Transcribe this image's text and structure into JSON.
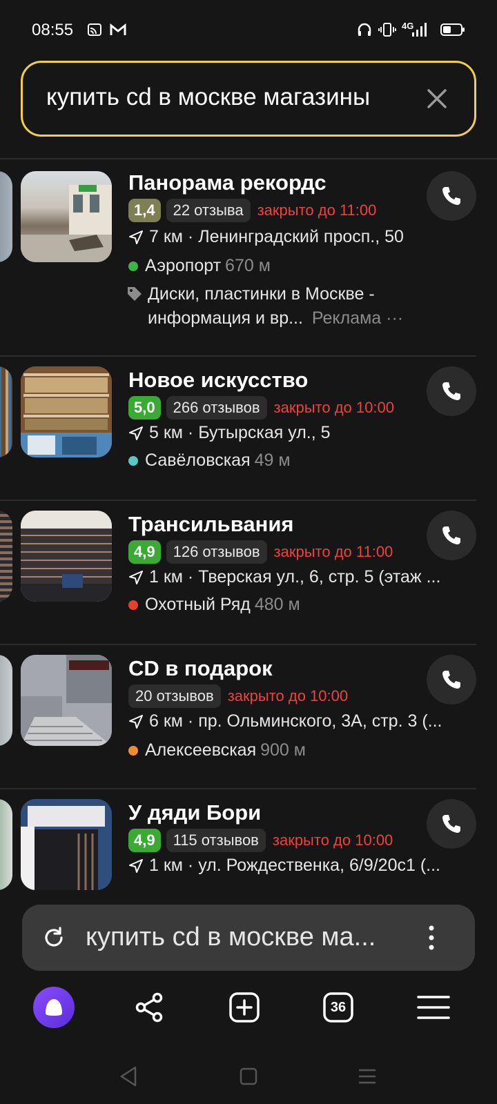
{
  "status_bar": {
    "time": "08:55",
    "network": "4G",
    "icons": [
      "cast-icon",
      "gmail-icon",
      "headphones-icon",
      "vibrate-icon",
      "signal-icon",
      "battery-icon"
    ]
  },
  "search": {
    "query": "купить cd в москве магазины",
    "clear_icon": "close-icon"
  },
  "results": [
    {
      "title": "Панорама рекордс",
      "rating": "1,4",
      "rating_color": "#7f7f55",
      "reviews": "22 отзыва",
      "status": "закрыто до 11:00",
      "distance_address": "7 км · Ленинградский просп., 50",
      "metro": "Аэропорт",
      "metro_distance": "670 м",
      "metro_color": "#3db34a",
      "ad_text_1": "Диски, пластинки в Москве -",
      "ad_text_2": "информация и вр...",
      "ad_label": "Реклама",
      "ad_more": "···"
    },
    {
      "title": "Новое искусство",
      "rating": "5,0",
      "rating_color": "#3aaa35",
      "reviews": "266 отзывов",
      "status": "закрыто до 10:00",
      "distance_address": "5 км · Бутырская ул., 5",
      "metro": "Савёловская",
      "metro_distance": "49 м",
      "metro_color": "#5ac6c6"
    },
    {
      "title": "Трансильвания",
      "rating": "4,9",
      "rating_color": "#3aaa35",
      "reviews": "126 отзывов",
      "status": "закрыто до 11:00",
      "distance_address": "1 км · Тверская ул., 6, стр. 5 (этаж ...",
      "metro": "Охотный Ряд",
      "metro_distance": "480 м",
      "metro_color": "#e8402f"
    },
    {
      "title": "CD в подарок",
      "reviews": "20 отзывов",
      "status": "закрыто до 10:00",
      "distance_address": "6 км · пр. Ольминского, 3А, стр. 3 (...",
      "metro": "Алексеевская",
      "metro_distance": "900 м",
      "metro_color": "#f18d2c"
    },
    {
      "title": "У дяди Бори",
      "rating": "4,9",
      "rating_color": "#3aaa35",
      "reviews": "115 отзывов",
      "status": "закрыто до 10:00",
      "distance_address": "1 км · ул. Рождественка, 6/9/20с1 (..."
    }
  ],
  "omnibox": {
    "text": "купить cd в москве ма..."
  },
  "toolbar": {
    "tabs_count": "36",
    "items": [
      "alice-icon",
      "share-icon",
      "new-tab-icon",
      "tabs-icon",
      "menu-icon"
    ]
  },
  "colors": {
    "accent_search_border": "#f2cf4a",
    "closed_red": "#f1413d",
    "background": "#161616"
  }
}
